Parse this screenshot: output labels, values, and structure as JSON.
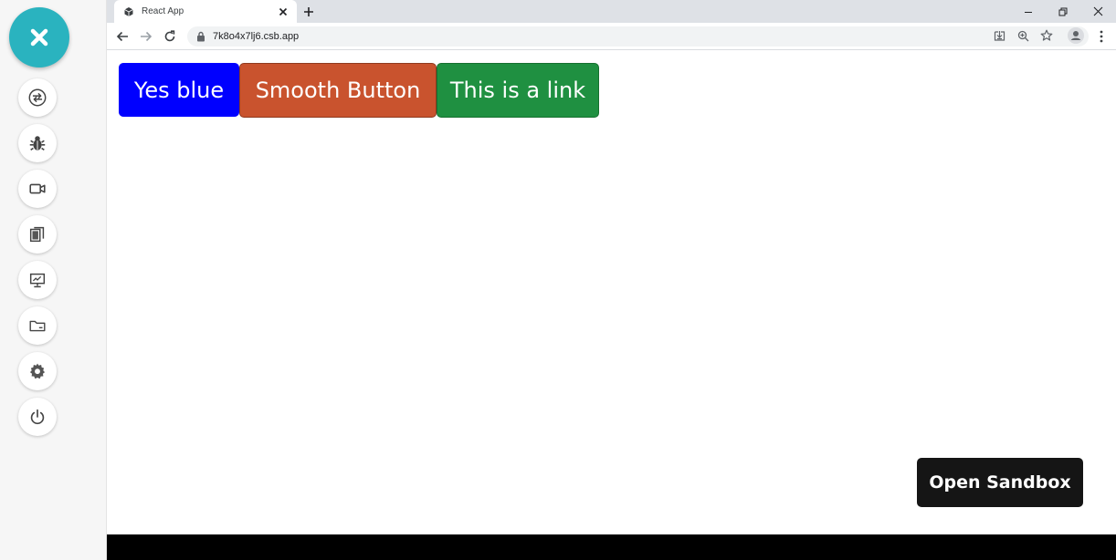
{
  "browser": {
    "tab": {
      "title": "React App",
      "favicon": "cube-icon"
    },
    "address_bar": {
      "url": "7k8o4x7lj6.csb.app"
    }
  },
  "sidebar": {
    "close_icon": "close-icon",
    "tools": [
      {
        "icon": "sync-icon"
      },
      {
        "icon": "bug-icon"
      },
      {
        "icon": "video-icon"
      },
      {
        "icon": "copy-icon"
      },
      {
        "icon": "presentation-icon"
      },
      {
        "icon": "folder-icon"
      },
      {
        "icon": "gear-icon"
      },
      {
        "icon": "power-icon"
      }
    ]
  },
  "page": {
    "buttons": [
      {
        "label": "Yes blue",
        "color": "#0000ff"
      },
      {
        "label": "Smooth Button",
        "color": "#c9532e"
      },
      {
        "label": "This is a link",
        "color": "#1f9041"
      }
    ],
    "open_sandbox_label": "Open Sandbox"
  },
  "colors": {
    "accent": "#2ab3bf",
    "sandbox_button": "#151515"
  }
}
